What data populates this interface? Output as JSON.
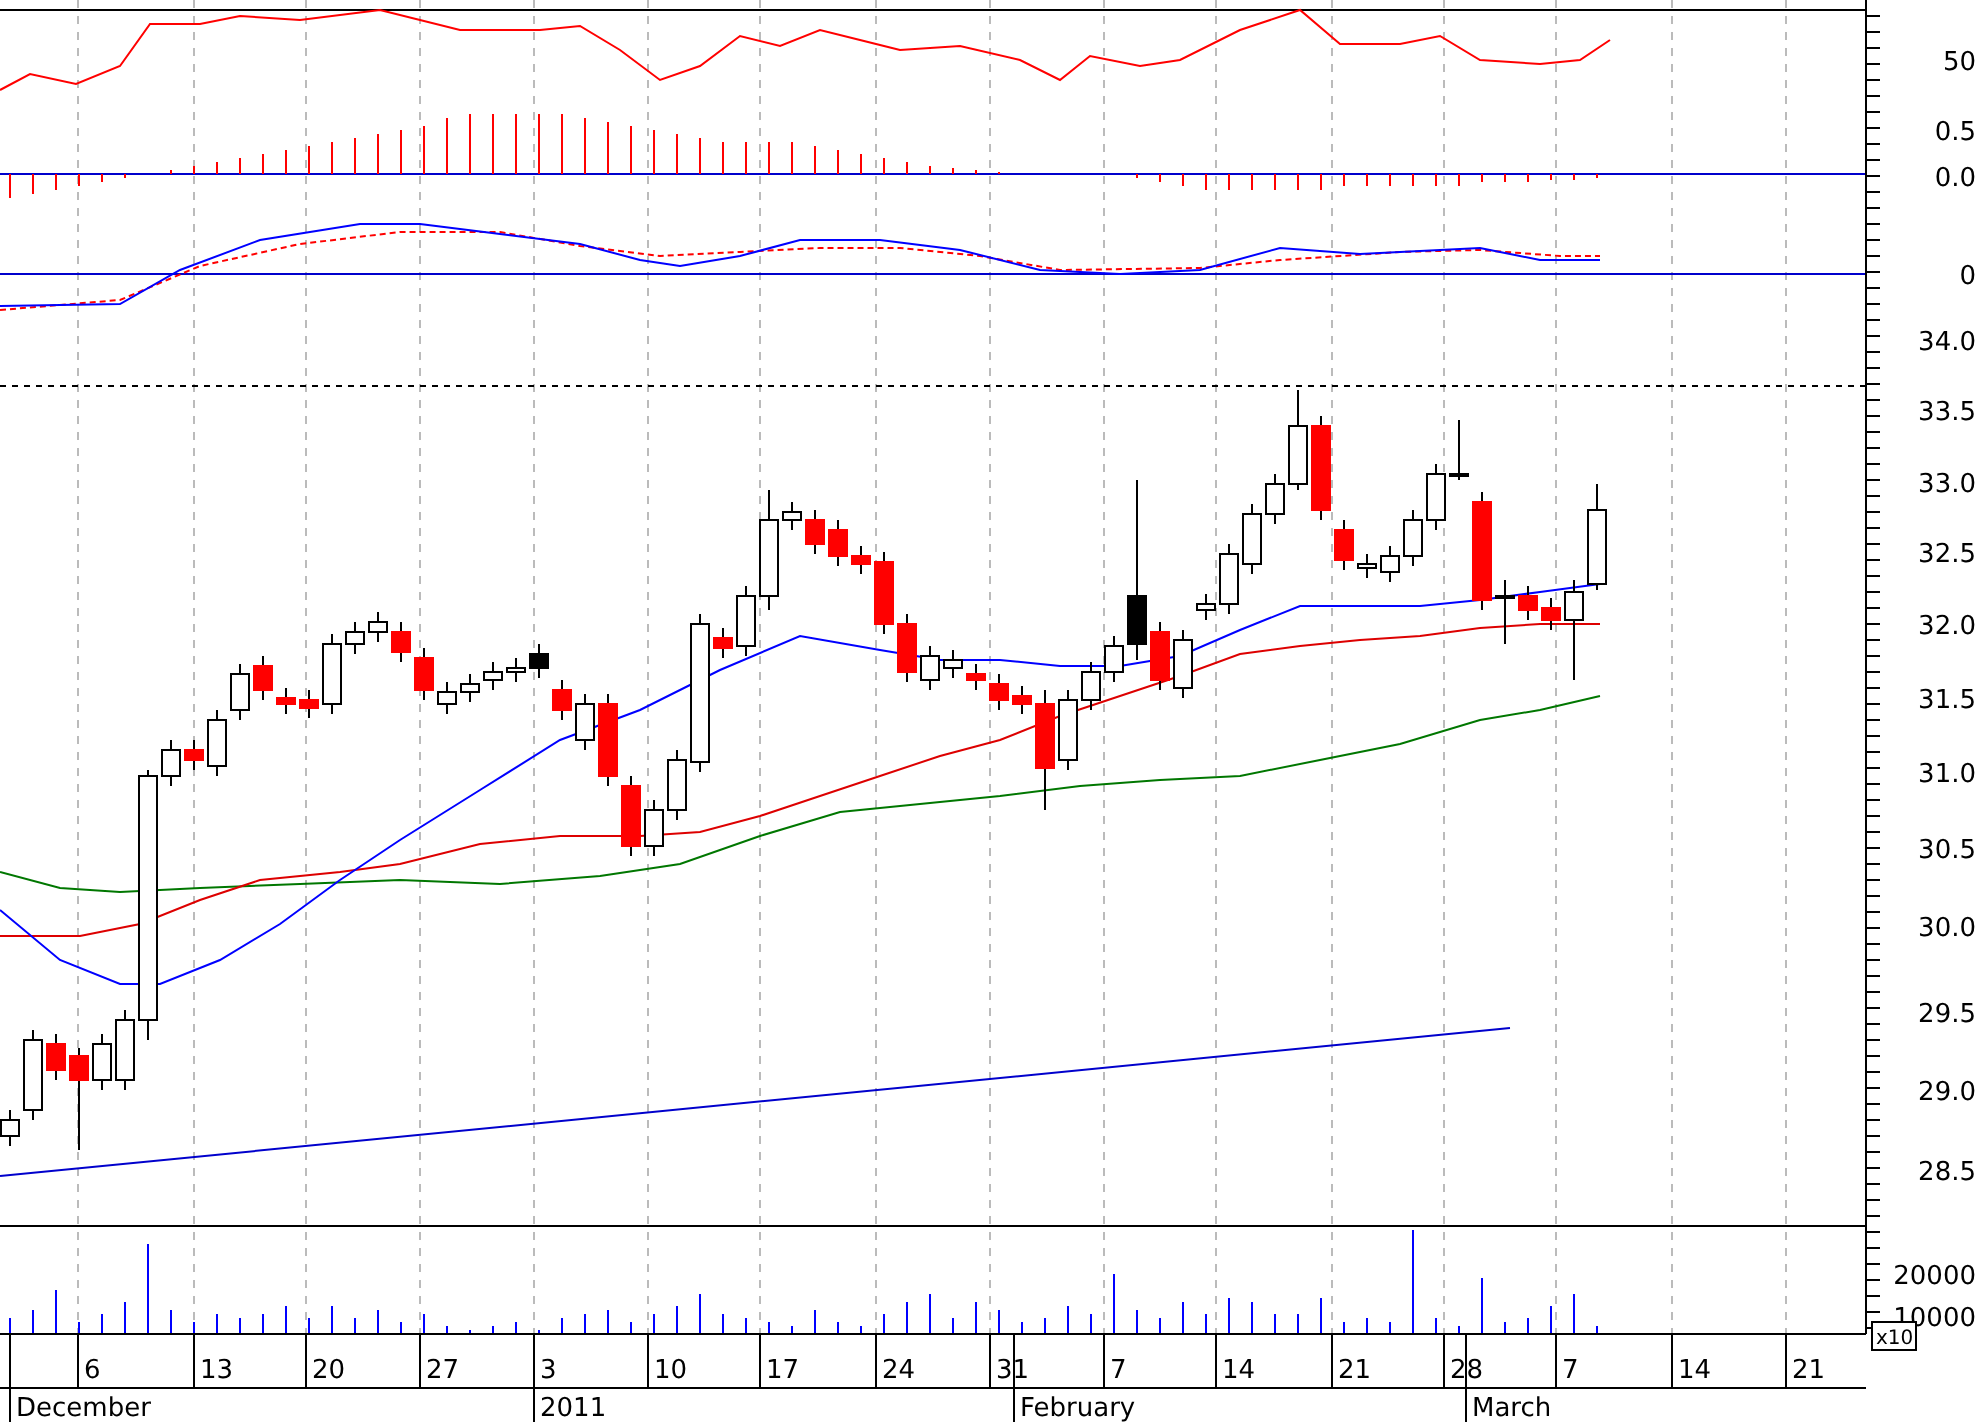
{
  "price_axis": {
    "labels": [
      "50",
      "0.5",
      "0.0",
      "0",
      "34.0",
      "33.5",
      "33.0",
      "32.5",
      "32.0",
      "31.5",
      "31.0",
      "30.5",
      "30.0",
      "29.5",
      "29.0",
      "28.5"
    ]
  },
  "volume_axis": {
    "labels": [
      "20000",
      "10000"
    ],
    "multiplier": "x10"
  },
  "date_axis": {
    "days": [
      "6",
      "13",
      "20",
      "27",
      "3",
      "10",
      "17",
      "24",
      "31",
      "7",
      "14",
      "21",
      "28",
      "7",
      "14",
      "21"
    ],
    "months": [
      "December",
      "2011",
      "February",
      "March"
    ]
  }
}
